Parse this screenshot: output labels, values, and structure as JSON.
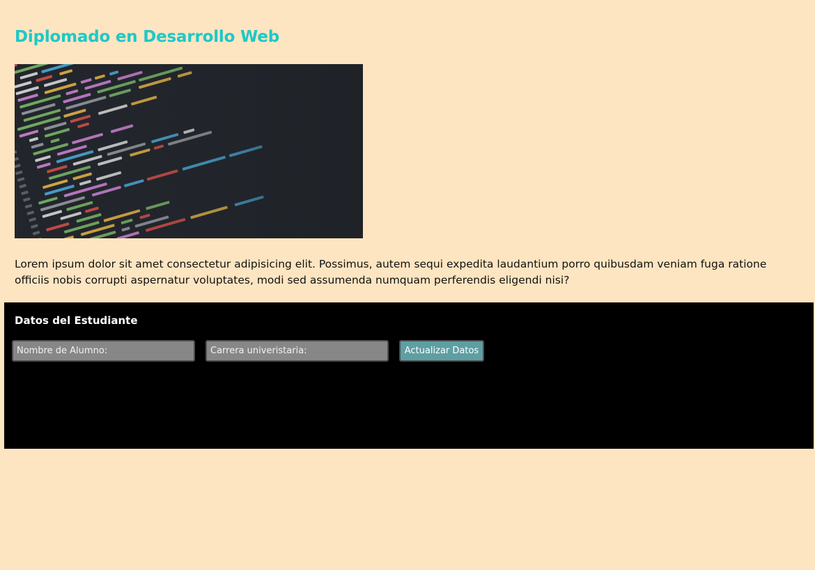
{
  "page": {
    "title": "Diplomado en Desarrollo Web",
    "hero_image": "code-editor-screenshot",
    "description": "Lorem ipsum dolor sit amet consectetur adipisicing elit. Possimus, autem sequi expedita laudantium porro quibusdam veniam fuga ratione officiis nobis corrupti aspernatur voluptates, modi sed assumenda numquam perferendis eligendi nisi?"
  },
  "student_panel": {
    "title": "Datos del Estudiante",
    "name_field": {
      "placeholder": "Nombre de Alumno:",
      "value": ""
    },
    "career_field": {
      "placeholder": "Carrera univeristaria:",
      "value": ""
    },
    "update_button": "Actualizar Datos"
  },
  "colors": {
    "background": "#fee5c1",
    "title": "#1fc8c6",
    "panel": "#000000",
    "field": "#878787",
    "button": "#5e9fa3"
  }
}
